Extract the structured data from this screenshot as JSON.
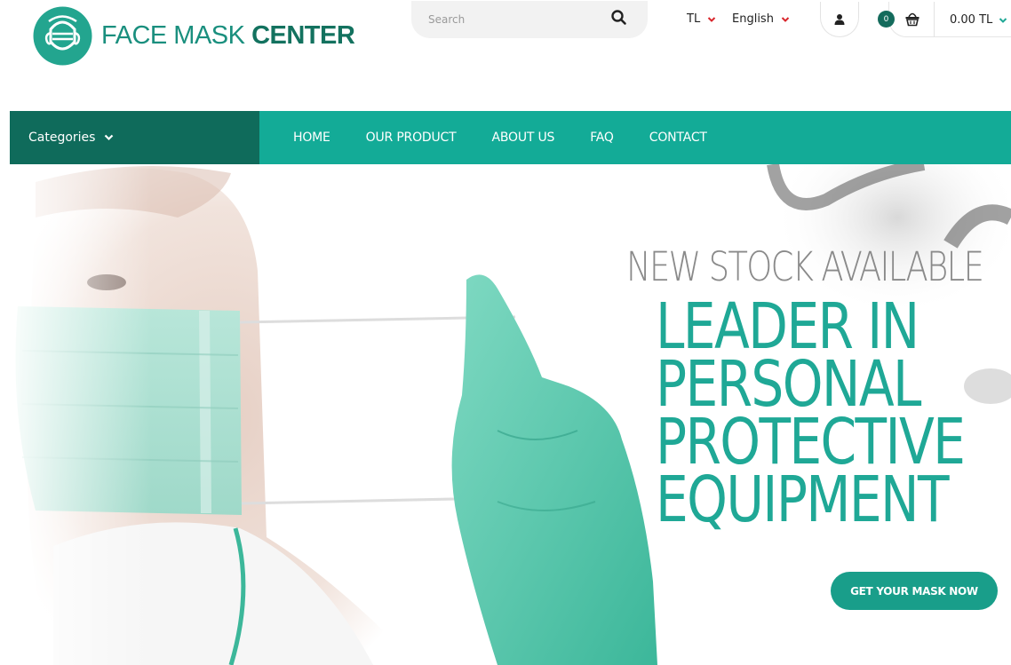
{
  "header": {
    "logo": {
      "word1": "FACE MASK",
      "word2": "CENTER",
      "icon": "face-mask-logo-icon"
    },
    "search": {
      "placeholder": "Search",
      "icon": "search-icon"
    },
    "currency": {
      "value": "TL",
      "icon": "chevron-down-icon"
    },
    "language": {
      "value": "English",
      "icon": "chevron-down-icon"
    },
    "account": {
      "icon": "user-icon"
    },
    "cart": {
      "count": "0",
      "total": "0.00 TL",
      "icon": "basket-icon"
    }
  },
  "nav": {
    "categories_label": "Categories",
    "items": [
      {
        "label": "HOME"
      },
      {
        "label": "OUR PRODUCT"
      },
      {
        "label": "ABOUT US"
      },
      {
        "label": "FAQ"
      },
      {
        "label": "CONTACT"
      }
    ]
  },
  "hero": {
    "eyebrow": "NEW STOCK AVAILABLE",
    "title_lines": [
      "LEADER IN",
      "PERSONAL",
      "PROTECTIVE",
      "EQUIPMENT"
    ],
    "cta_label": "GET YOUR MASK NOW"
  },
  "colors": {
    "brand_teal": "#13ab97",
    "brand_dark": "#0f6b5b",
    "cta": "#199e8a",
    "title_teal": "#1fa896"
  }
}
